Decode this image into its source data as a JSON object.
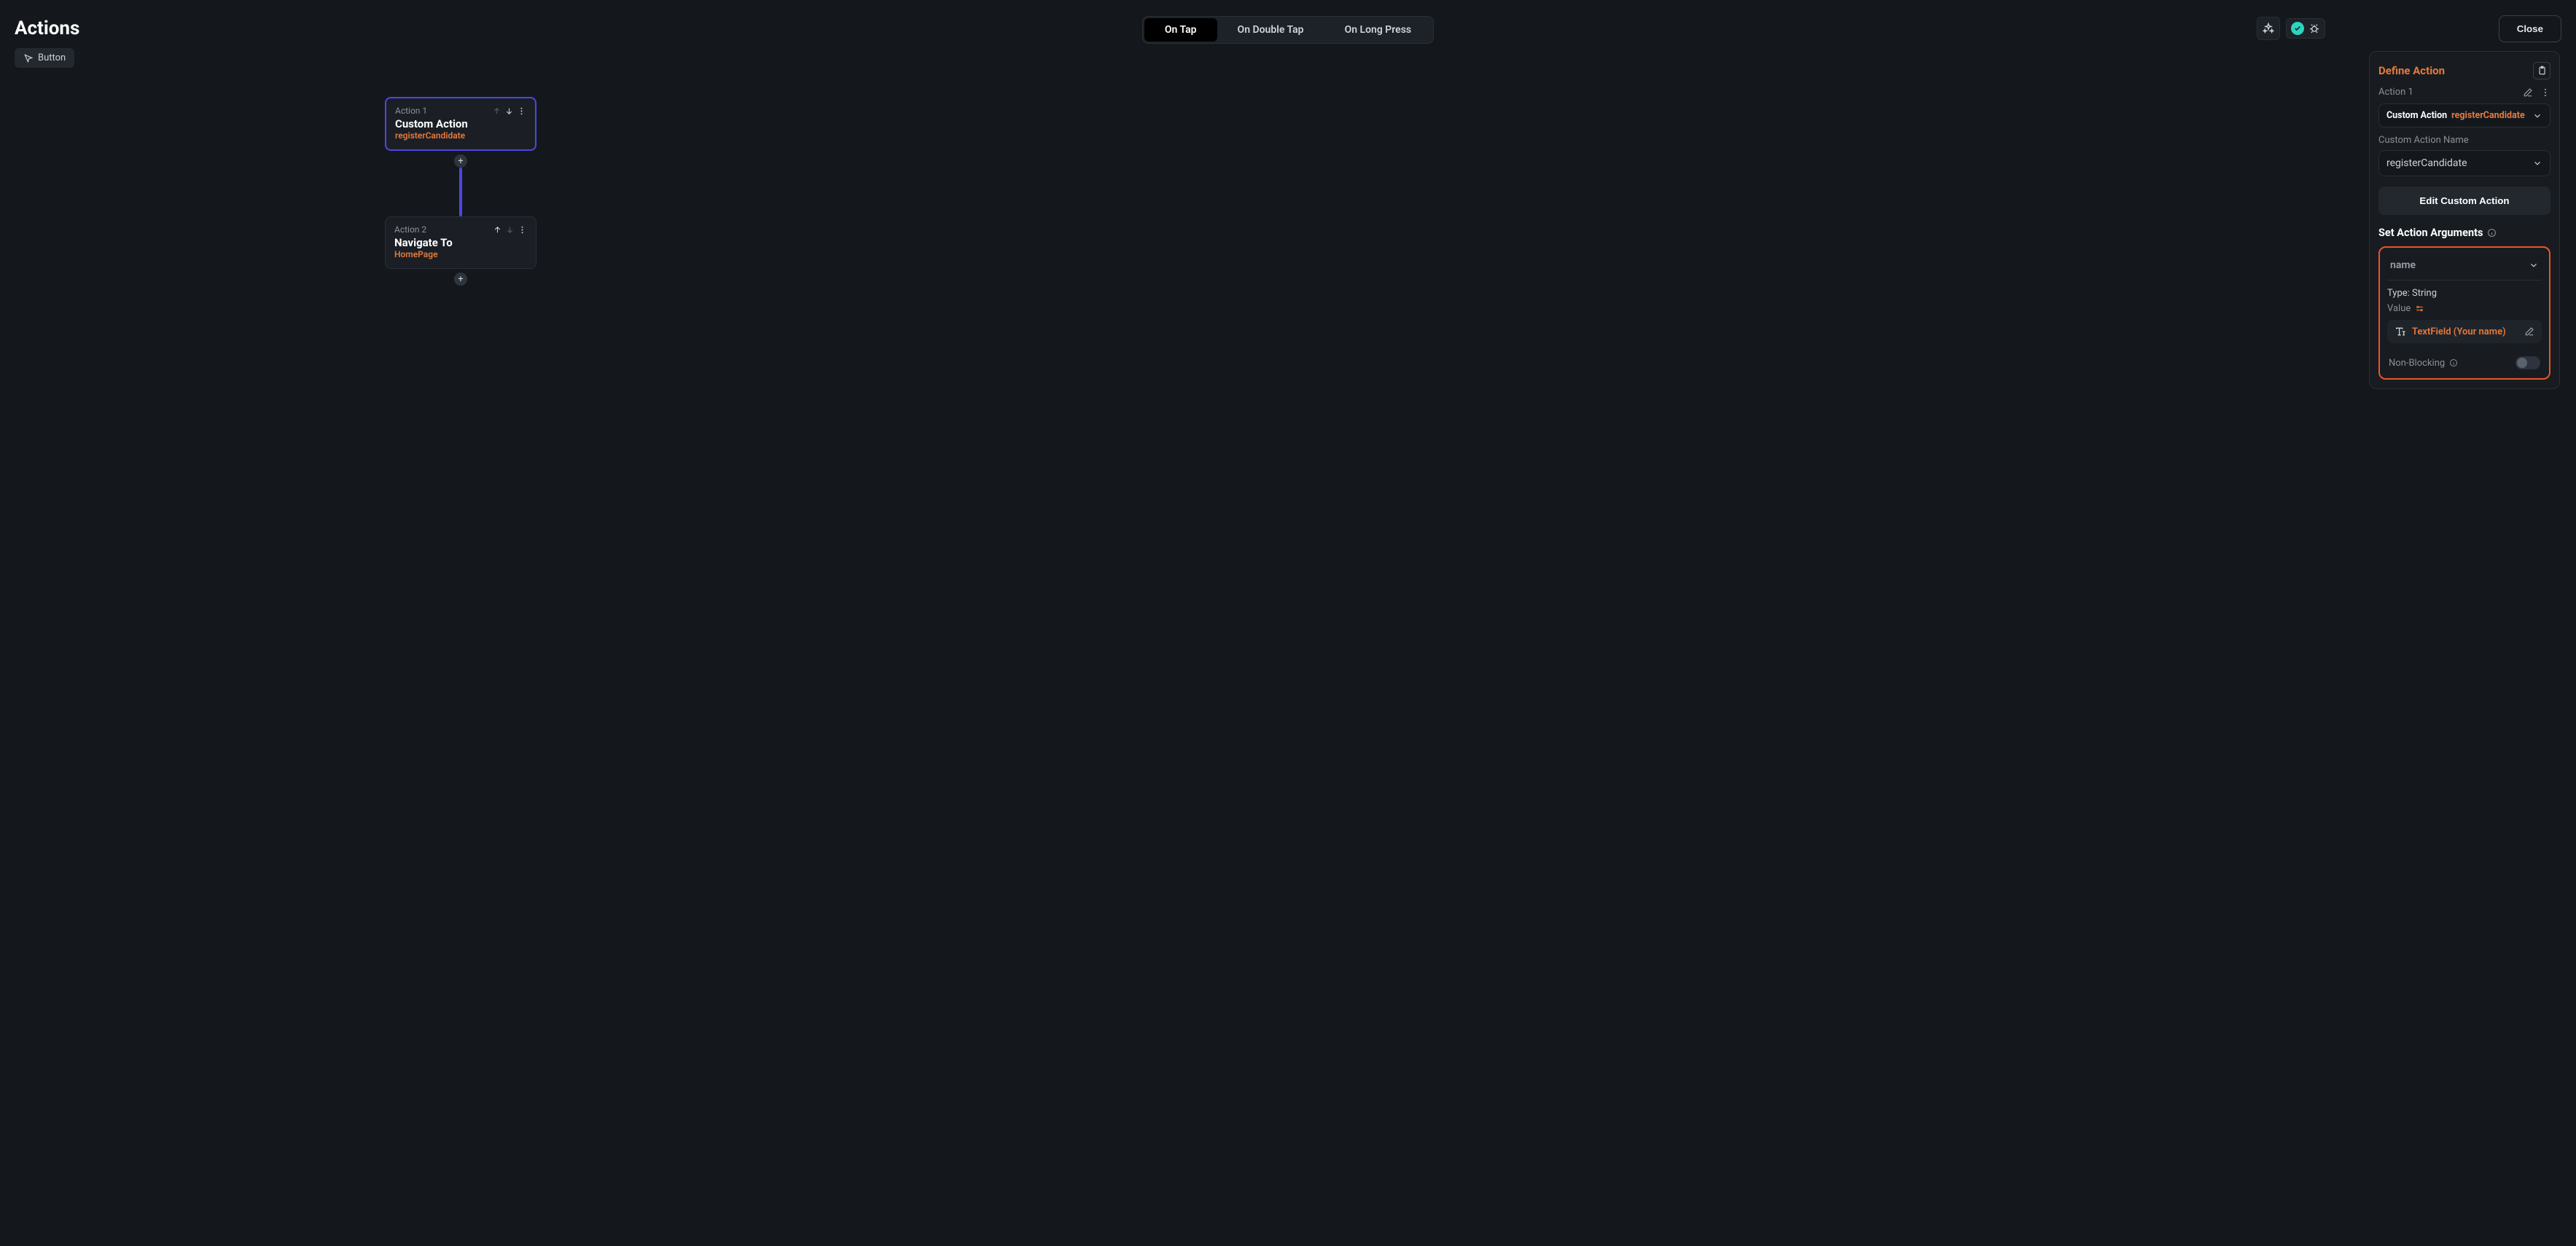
{
  "header": {
    "title": "Actions",
    "tabs": [
      "On Tap",
      "On Double Tap",
      "On Long Press"
    ],
    "active_tab": 0,
    "close_label": "Close"
  },
  "chip": {
    "label": "Button"
  },
  "nodes": {
    "n1": {
      "num": "Action 1",
      "title": "Custom Action",
      "sub": "registerCandidate"
    },
    "n2": {
      "num": "Action 2",
      "title": "Navigate To",
      "sub": "HomePage"
    }
  },
  "panel": {
    "title": "Define Action",
    "action_label": "Action 1",
    "type_select": {
      "label": "Custom Action",
      "value": "registerCandidate"
    },
    "name_label": "Custom Action Name",
    "name_value": "registerCandidate",
    "edit_btn": "Edit Custom Action",
    "args_title": "Set Action Arguments",
    "arg": {
      "name": "name",
      "type_label": "Type: String",
      "value_label": "Value",
      "value_text": "TextField (Your name)"
    },
    "nonblocking_label": "Non-Blocking"
  },
  "colors": {
    "accent": "#e67a3c",
    "indigo": "#4f46e5"
  }
}
